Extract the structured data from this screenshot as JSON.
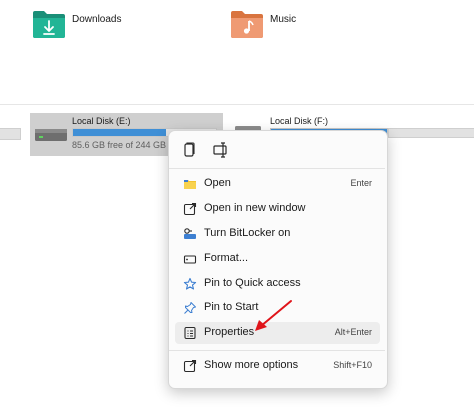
{
  "folders": [
    {
      "label": "Downloads",
      "icon": "downloads-folder-icon",
      "color": "#1fa58a"
    },
    {
      "label": "Music",
      "icon": "music-folder-icon",
      "color": "#e58a5e"
    }
  ],
  "drives": [
    {
      "name": "Local Disk (E:)",
      "free_text": "85.6 GB free of 244 GB",
      "used_fraction": 0.65
    },
    {
      "name": "Local Disk (F:)"
    }
  ],
  "context_menu": {
    "top_icons": [
      "copy-icon",
      "rename-icon"
    ],
    "items": [
      {
        "label": "Open",
        "shortcut": "Enter",
        "icon": "open-folder-icon"
      },
      {
        "label": "Open in new window",
        "shortcut": "",
        "icon": "new-window-icon"
      },
      {
        "label": "Turn BitLocker on",
        "shortcut": "",
        "icon": "bitlocker-key-icon"
      },
      {
        "label": "Format...",
        "shortcut": "",
        "icon": "format-drive-icon"
      },
      {
        "label": "Pin to Quick access",
        "shortcut": "",
        "icon": "star-icon"
      },
      {
        "label": "Pin to Start",
        "shortcut": "",
        "icon": "pin-icon"
      },
      {
        "label": "Properties",
        "shortcut": "Alt+Enter",
        "icon": "properties-icon"
      },
      {
        "label": "Show more options",
        "shortcut": "Shift+F10",
        "icon": "more-options-icon"
      }
    ]
  },
  "colors": {
    "accent": "#3f8fd6",
    "arrow": "#e0141a",
    "selection": "#cfcfcf"
  }
}
